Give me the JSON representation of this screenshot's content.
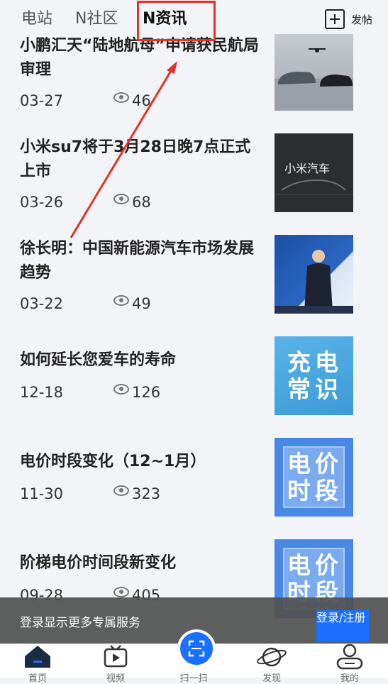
{
  "tabs": {
    "station": "电站",
    "community": "N社区",
    "news": "N资讯"
  },
  "post_button": "发帖",
  "articles": [
    {
      "title": "小鹏汇天“陆地航母”申请获民航局审理",
      "date": "03-27",
      "views": "46"
    },
    {
      "title": "小米su7将于3月28日晚7点正式上市",
      "date": "03-26",
      "views": "68",
      "thumb_text": "小米汽车"
    },
    {
      "title": "徐长明：中国新能源汽车市场发展趋势",
      "date": "03-22",
      "views": "49"
    },
    {
      "title": "如何延长您爱车的寿命",
      "date": "12-18",
      "views": "126",
      "thumb_text": [
        "充",
        "电",
        "常",
        "识"
      ]
    },
    {
      "title": "电价时段变化（12~1月）",
      "date": "11-30",
      "views": "323",
      "thumb_text": [
        "电",
        "价",
        "时",
        "段"
      ]
    },
    {
      "title": "阶梯电价时间段新变化",
      "date": "09-28",
      "views": "405",
      "thumb_text": [
        "电",
        "价",
        "时",
        "段"
      ]
    }
  ],
  "banner": {
    "message": "登录显示更多专属服务",
    "login_button": "登录/注册"
  },
  "tabbar": [
    {
      "label": "首页",
      "icon": "home-icon"
    },
    {
      "label": "视频",
      "icon": "video-icon"
    },
    {
      "label": "扫一扫",
      "icon": "scan-icon"
    },
    {
      "label": "发现",
      "icon": "planet-icon"
    },
    {
      "label": "我的",
      "icon": "profile-icon"
    }
  ],
  "colors": {
    "accent": "#1a6fff",
    "highlight": "#e5312b",
    "background": "#f3f4f7"
  }
}
